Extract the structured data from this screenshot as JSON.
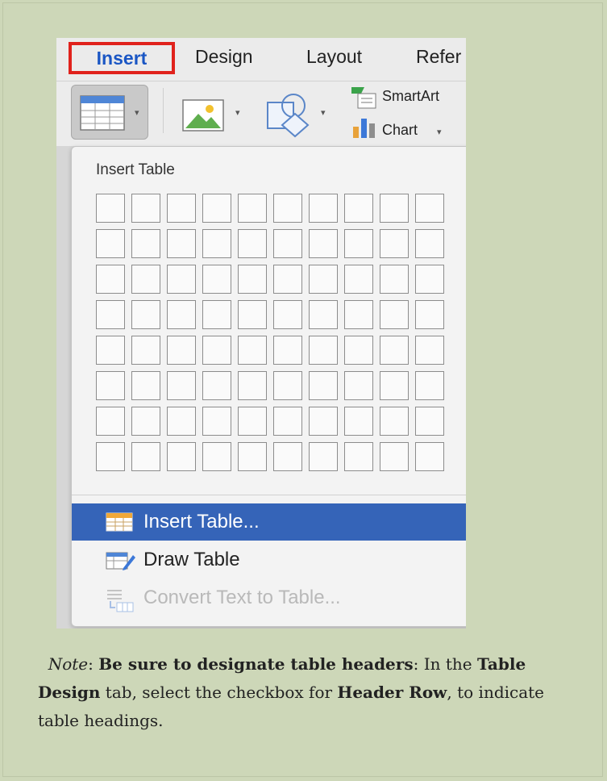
{
  "tabs": [
    {
      "label": "Insert",
      "highlighted": true
    },
    {
      "label": "Design"
    },
    {
      "label": "Layout"
    },
    {
      "label": "Refer"
    }
  ],
  "ribbon": {
    "table_icon": "table-icon",
    "picture_icon": "picture-icon",
    "shapes_icon": "shapes-icon",
    "smartart_label": "SmartArt",
    "chart_label": "Chart",
    "caret": "▾"
  },
  "dropdown": {
    "title": "Insert Table",
    "grid": {
      "columns": 10,
      "rows": 8
    },
    "items": [
      {
        "label": "Insert Table...",
        "icon": "table-icon",
        "selected": true,
        "enabled": true
      },
      {
        "label": "Draw Table",
        "icon": "draw-table-icon",
        "enabled": true
      },
      {
        "label": "Convert Text to Table...",
        "icon": "convert-text-icon",
        "enabled": false
      }
    ]
  },
  "note": {
    "prefix": "Note",
    "colon": ": ",
    "bold1": "Be sure to designate table headers",
    "text1": ": In the ",
    "bold2": "Table Design",
    "text2": " tab, select the checkbox for ",
    "bold3": "Header Row",
    "text3": ", to indicate table headings."
  },
  "colors": {
    "background": "#cdd7b8",
    "highlight_box": "#e0221c",
    "insert_tab_text": "#1a56c4",
    "selected_item": "#3564b8"
  }
}
